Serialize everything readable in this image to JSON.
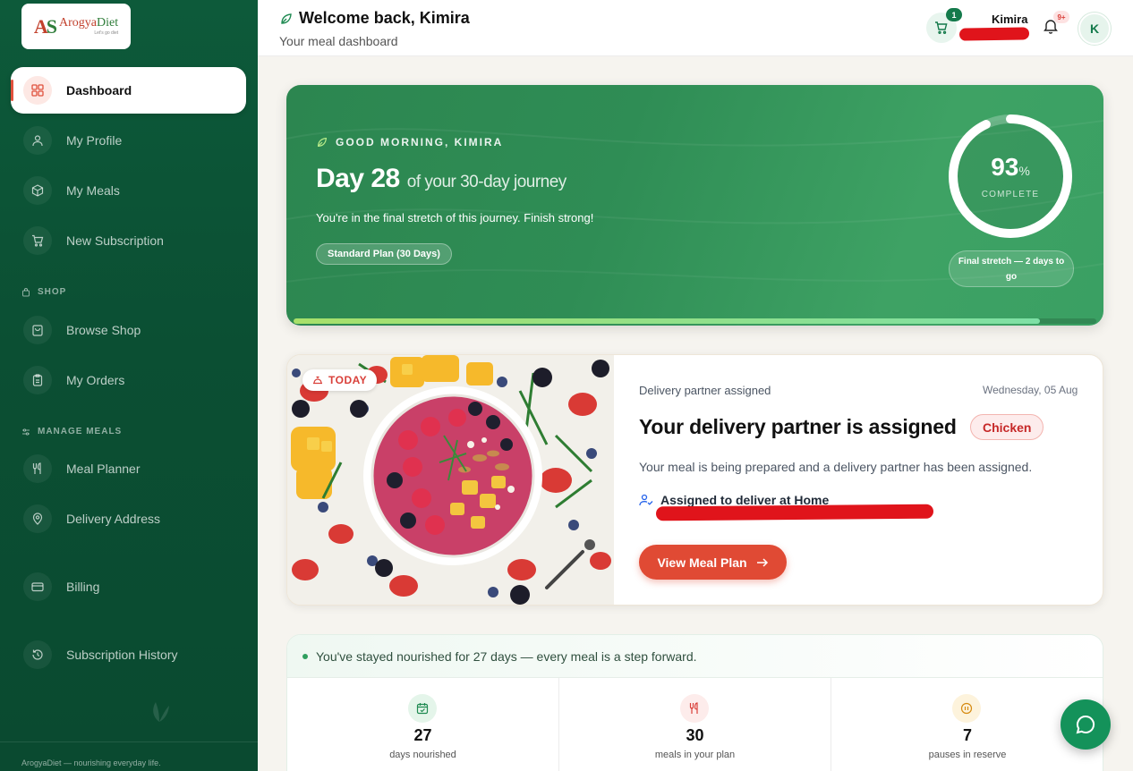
{
  "brand": {
    "logo_mark": "AD",
    "name_a": "Arogya",
    "name_b": "Diet",
    "tagline": "Let's go diet"
  },
  "sidebar": {
    "items": [
      {
        "label": "Dashboard",
        "icon": "grid-icon"
      },
      {
        "label": "My Profile",
        "icon": "user-icon"
      },
      {
        "label": "My Meals",
        "icon": "package-icon"
      },
      {
        "label": "New Subscription",
        "icon": "cart-icon"
      },
      {
        "label": "Browse Shop",
        "icon": "shopping-bag-icon"
      },
      {
        "label": "My Orders",
        "icon": "clipboard-icon"
      },
      {
        "label": "Meal Planner",
        "icon": "utensils-icon"
      },
      {
        "label": "Delivery Address",
        "icon": "map-pin-icon"
      },
      {
        "label": "Billing",
        "icon": "credit-card-icon"
      },
      {
        "label": "Subscription History",
        "icon": "history-icon"
      }
    ],
    "sections": {
      "shop": "SHOP",
      "manage": "MANAGE MEALS"
    },
    "footer": "ArogyaDiet — nourishing everyday life."
  },
  "header": {
    "title": "Welcome back, Kimira",
    "subtitle": "Your meal dashboard",
    "cart_count": "1",
    "user_name": "Kimira",
    "notif_count": "9+",
    "avatar_initial": "K"
  },
  "hero": {
    "greeting": "GOOD MORNING, KIMIRA",
    "day": "Day 28",
    "journey": "of your 30-day journey",
    "message": "You're in the final stretch of this journey. Finish strong!",
    "plan": "Standard Plan (30 Days)",
    "percent": "93",
    "percent_sign": "%",
    "progress": 0.93,
    "complete_label": "COMPLETE",
    "stretch": "Final stretch — 2 days to go"
  },
  "delivery": {
    "today": "TODAY",
    "status": "Delivery partner assigned",
    "date": "Wednesday, 05 Aug",
    "title": "Your delivery partner is assigned",
    "tag": "Chicken",
    "description": "Your meal is being prepared and a delivery partner has been assigned.",
    "assigned": "Assigned to deliver at Home",
    "button": "View Meal Plan"
  },
  "stats": {
    "message": "You've stayed nourished for 27 days — every meal is a step forward.",
    "items": [
      {
        "value": "27",
        "label": "days nourished",
        "icon": "calendar-check-icon"
      },
      {
        "value": "30",
        "label": "meals in your plan",
        "icon": "utensils-icon"
      },
      {
        "value": "7",
        "label": "pauses in reserve",
        "icon": "pause-icon"
      }
    ]
  },
  "colors": {
    "sidebar": "#0d5a3a",
    "hero": "#2f8d55",
    "accent": "#e04a34",
    "brand_green": "#147a4b"
  }
}
